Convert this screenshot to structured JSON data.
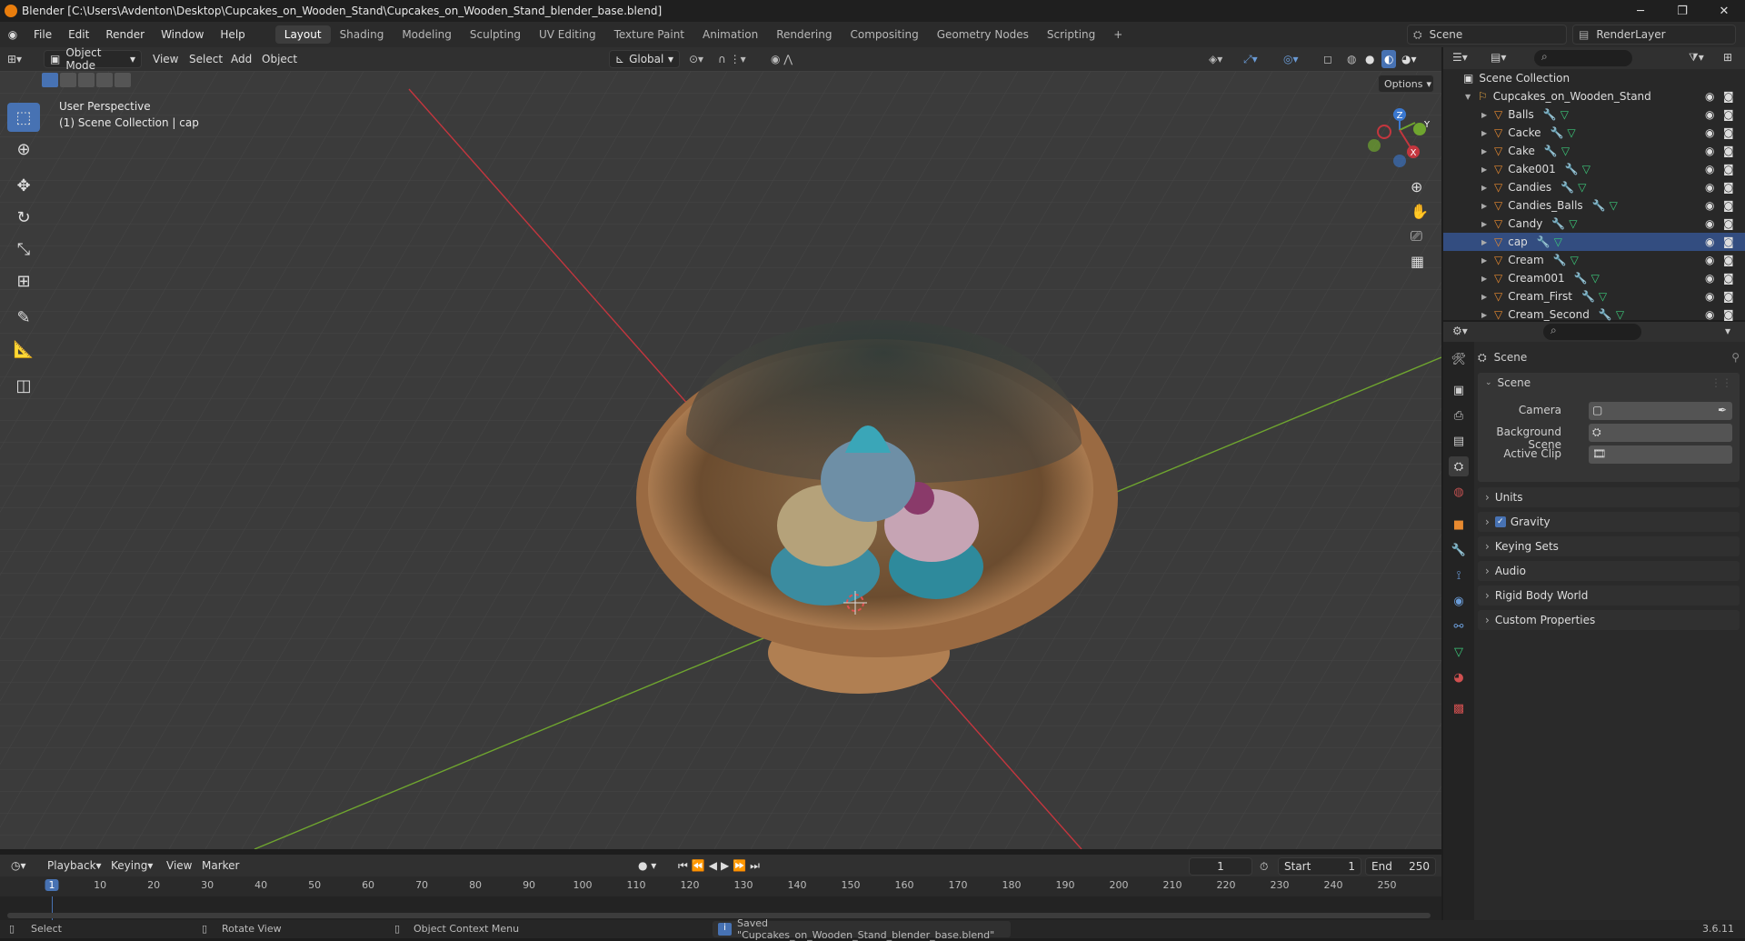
{
  "window": {
    "title": "Blender [C:\\Users\\Avdenton\\Desktop\\Cupcakes_on_Wooden_Stand\\Cupcakes_on_Wooden_Stand_blender_base.blend]",
    "controls": [
      "─",
      "❐",
      "✕"
    ]
  },
  "menu": {
    "items": [
      "File",
      "Edit",
      "Render",
      "Window",
      "Help"
    ],
    "workspaces": [
      "Layout",
      "Shading",
      "Modeling",
      "Sculpting",
      "UV Editing",
      "Texture Paint",
      "Animation",
      "Rendering",
      "Compositing",
      "Geometry Nodes",
      "Scripting"
    ],
    "active_workspace": "Layout",
    "add_tab": "+",
    "scene": "Scene",
    "view_layer": "RenderLayer"
  },
  "viewport_header": {
    "mode": "Object Mode",
    "menus": [
      "View",
      "Select",
      "Add",
      "Object"
    ],
    "orientation": "Global",
    "options": "Options"
  },
  "viewport": {
    "perspective": "User Perspective",
    "collection_info": "(1) Scene Collection | cap"
  },
  "gizmo": {
    "x": "X",
    "y": "Y",
    "z": "Z"
  },
  "outliner": {
    "root": "Scene Collection",
    "collection": "Cupcakes_on_Wooden_Stand",
    "objects": [
      "Balls",
      "Cacke",
      "Cake",
      "Cake001",
      "Candies",
      "Candies_Balls",
      "Candy",
      "cap",
      "Cream",
      "Cream001",
      "Cream_First",
      "Cream_Second"
    ],
    "selected": "cap"
  },
  "properties": {
    "title": "Scene",
    "panel": "Scene",
    "fields": [
      {
        "label": "Camera"
      },
      {
        "label": "Background Scene"
      },
      {
        "label": "Active Clip"
      }
    ],
    "subpanels": [
      "Units",
      "Gravity",
      "Keying Sets",
      "Audio",
      "Rigid Body World",
      "Custom Properties"
    ],
    "gravity_checked": true
  },
  "timeline": {
    "menus": [
      "Playback",
      "Keying",
      "View",
      "Marker"
    ],
    "current_frame": "1",
    "start_label": "Start",
    "start": "1",
    "end_label": "End",
    "end": "250",
    "ticks": [
      "1",
      "10",
      "20",
      "30",
      "40",
      "50",
      "60",
      "70",
      "80",
      "90",
      "100",
      "110",
      "120",
      "130",
      "140",
      "150",
      "160",
      "170",
      "180",
      "190",
      "200",
      "210",
      "220",
      "230",
      "240",
      "250"
    ]
  },
  "status": {
    "select": "Select",
    "rotate": "Rotate View",
    "context": "Object Context Menu",
    "message": "Saved \"Cupcakes_on_Wooden_Stand_blender_base.blend\"",
    "version": "3.6.11"
  },
  "colors": {
    "accent": "#4772b3",
    "x_axis": "#c4363e",
    "y_axis": "#6fa52f",
    "selection": "#334d80"
  }
}
